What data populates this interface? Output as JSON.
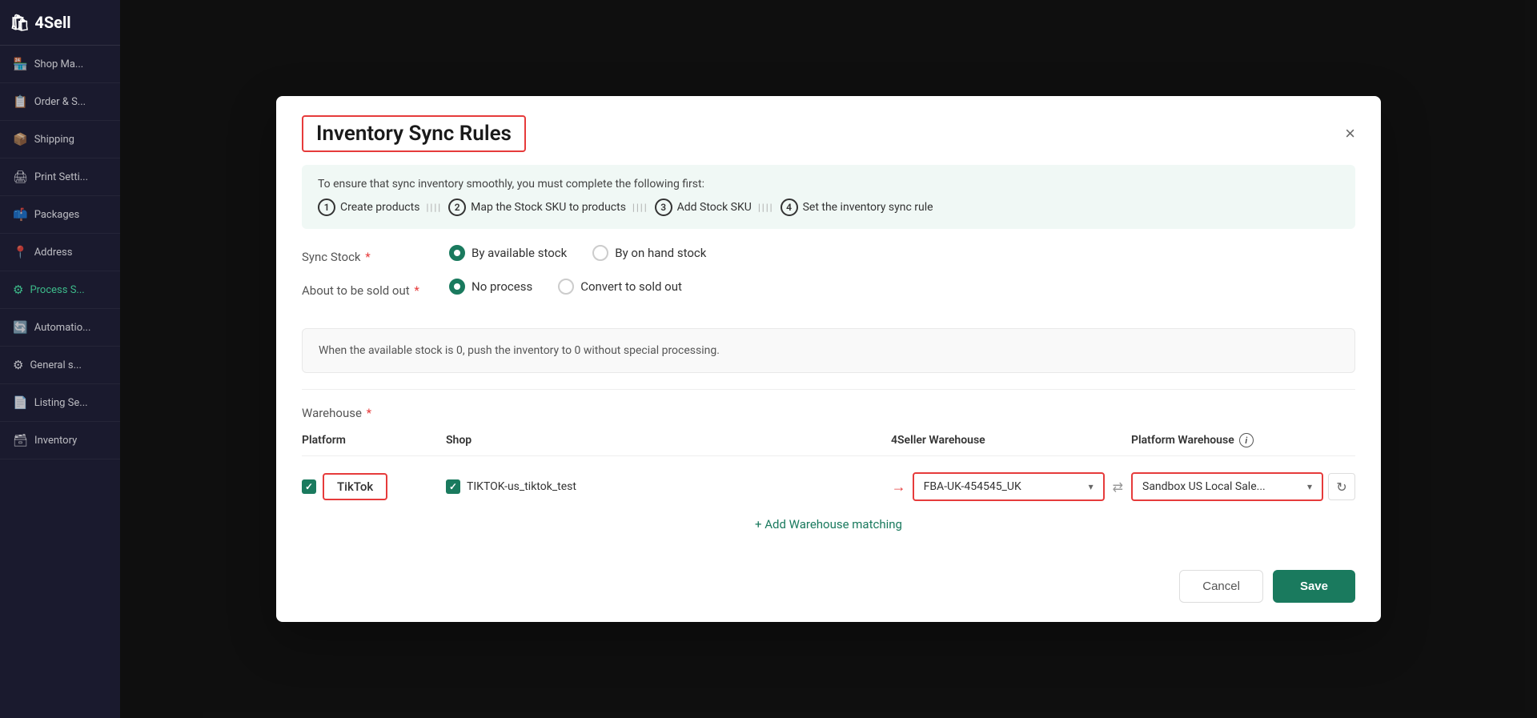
{
  "sidebar": {
    "logo": "4Sell",
    "logo_icon": "🛍",
    "items": [
      {
        "id": "shop-management",
        "label": "Shop Ma...",
        "icon": "🏪",
        "active": false
      },
      {
        "id": "order-sync",
        "label": "Order & S...",
        "icon": "📋",
        "active": false
      },
      {
        "id": "shipping",
        "label": "Shipping",
        "icon": "📦",
        "active": false
      },
      {
        "id": "print-settings",
        "label": "Print Setti...",
        "icon": "🖨",
        "active": false
      },
      {
        "id": "packages",
        "label": "Packages",
        "icon": "📫",
        "active": false
      },
      {
        "id": "address",
        "label": "Address",
        "icon": "📍",
        "active": false
      },
      {
        "id": "process-s",
        "label": "Process S...",
        "icon": "⚙",
        "active": true
      },
      {
        "id": "automation",
        "label": "Automatio...",
        "icon": "🔄",
        "active": false
      },
      {
        "id": "general-s",
        "label": "General s...",
        "icon": "⚙",
        "active": false
      },
      {
        "id": "listing-se",
        "label": "Listing Se...",
        "icon": "📄",
        "active": false
      },
      {
        "id": "inventory",
        "label": "Inventory",
        "icon": "🗃",
        "active": false
      }
    ]
  },
  "modal": {
    "title": "Inventory Sync Rules",
    "close_label": "×",
    "info_banner": {
      "text": "To ensure that sync inventory smoothly, you must complete the following first:",
      "steps": [
        {
          "num": "1",
          "label": "Create products"
        },
        {
          "num": "2",
          "label": "Map the Stock SKU to products"
        },
        {
          "num": "3",
          "label": "Add Stock SKU"
        },
        {
          "num": "4",
          "label": "Set the inventory sync rule"
        }
      ]
    },
    "sync_stock": {
      "label": "Sync Stock",
      "required": "*",
      "options": [
        {
          "id": "by-available",
          "label": "By available stock",
          "selected": true
        },
        {
          "id": "by-on-hand",
          "label": "By on hand stock",
          "selected": false
        }
      ]
    },
    "about_to_be_sold_out": {
      "label": "About to be sold out",
      "required": "*",
      "options": [
        {
          "id": "no-process",
          "label": "No process",
          "selected": true
        },
        {
          "id": "convert-to-sold-out",
          "label": "Convert to sold out",
          "selected": false
        }
      ],
      "info_text": "When the available stock is 0, push the inventory to 0 without special processing."
    },
    "warehouse": {
      "label": "Warehouse",
      "required": "*",
      "table": {
        "headers": {
          "platform": "Platform",
          "shop": "Shop",
          "seller_warehouse": "4Seller Warehouse",
          "platform_warehouse": "Platform Warehouse"
        },
        "rows": [
          {
            "platform_checked": true,
            "platform": "TikTok",
            "shop_checked": true,
            "shop": "TIKTOK-us_tiktok_test",
            "seller_warehouse": "FBA-UK-454545_UK",
            "platform_warehouse": "Sandbox US Local Sale..."
          }
        ]
      },
      "add_warehouse_label": "+ Add Warehouse matching"
    },
    "footer": {
      "cancel_label": "Cancel",
      "save_label": "Save"
    }
  }
}
